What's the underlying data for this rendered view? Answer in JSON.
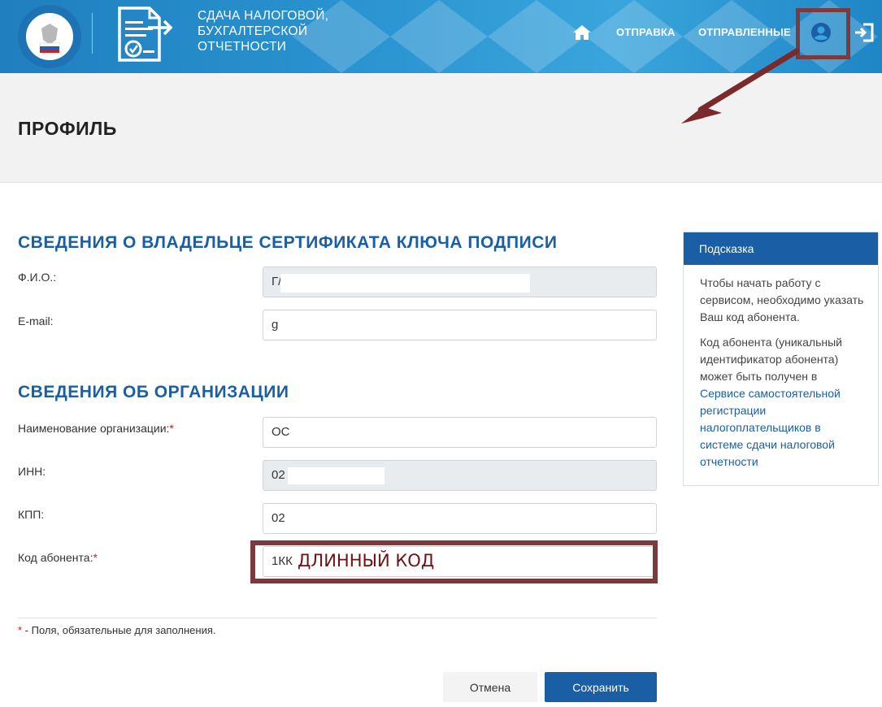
{
  "header": {
    "service_title_lines": [
      "СДАЧА НАЛОГОВОЙ,",
      "БУХГАЛТЕРСКОЙ",
      "ОТЧЕТНОСТИ"
    ],
    "nav": {
      "home_icon": "home-icon",
      "send_label": "ОТПРАВКА",
      "sent_label": "ОТПРАВЛЕННЫЕ",
      "profile_icon": "user-circle-icon",
      "exit_icon": "sign-out-icon"
    }
  },
  "page": {
    "title": "ПРОФИЛЬ"
  },
  "owner_section": {
    "title": "СВЕДЕНИЯ О ВЛАДЕЛЬЦЕ СЕРТИФИКАТА КЛЮЧА ПОДПИСИ",
    "fio_label": "Ф.И.О.:",
    "fio_value": "Г/",
    "email_label": "E-mail:",
    "email_value": "g"
  },
  "org_section": {
    "title": "СВЕДЕНИЯ ОБ ОРГАНИЗАЦИИ",
    "name_label": "Наименование организации:",
    "name_value": "ОС",
    "inn_label": "ИНН:",
    "inn_value": "02",
    "kpp_label": "КПП:",
    "kpp_value": "02",
    "code_label": "Код абонента:",
    "code_value": "1КК",
    "code_annotation": "ДЛИННЫЙ КОД",
    "required_mark": "*"
  },
  "footer": {
    "required_note_star": "*",
    "required_note": " - Поля, обязательные для заполнения.",
    "cancel_label": "Отмена",
    "save_label": "Сохранить"
  },
  "hint": {
    "title": "Подсказка",
    "paragraph1": "Чтобы начать работу с сервисом, необходимо указать Ваш код абонента.",
    "paragraph2_text": "Код абонента (уникальный идентификатор абонента) может быть получен в ",
    "paragraph2_link": "Сервисе самостоятельной регистрации налогоплательщиков в системе сдачи налоговой отчетности"
  },
  "colors": {
    "header_blue": "#2a93d0",
    "section_blue": "#1a5fa6",
    "annotation_maroon": "#7b3b3c"
  }
}
